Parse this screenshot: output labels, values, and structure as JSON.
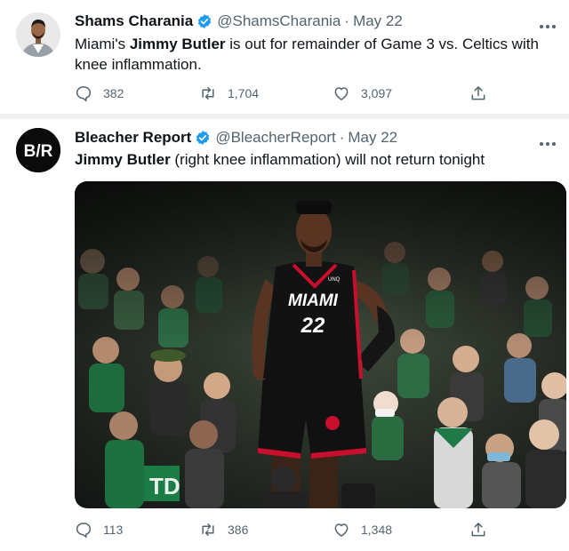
{
  "tweets": [
    {
      "author_name": "Shams Charania",
      "handle": "@ShamsCharania",
      "separator": "·",
      "date": "May 22",
      "text_parts": [
        {
          "text": "Miami's ",
          "bold": false
        },
        {
          "text": "Jimmy Butler",
          "bold": true
        },
        {
          "text": " is out for remainder of Game 3 vs. Celtics with knee inflammation.",
          "bold": false
        }
      ],
      "replies": "382",
      "retweets": "1,704",
      "likes": "3,097"
    },
    {
      "author_name": "Bleacher Report",
      "handle": "@BleacherReport",
      "separator": "·",
      "date": "May 22",
      "avatar_text": "B/R",
      "text_parts": [
        {
          "text": "Jimmy Butler",
          "bold": true
        },
        {
          "text": " (right knee inflammation) will not return tonight",
          "bold": false
        }
      ],
      "media": {
        "jersey_team": "MIAMI",
        "jersey_number": "22",
        "court_sign": "TD",
        "brand_mark": "UNQ"
      },
      "replies": "113",
      "retweets": "386",
      "likes": "1,348"
    }
  ],
  "colors": {
    "verified": "#1d9bf0",
    "secondary_text": "#536471",
    "primary_text": "#0f1419",
    "divider": "#eef0f2"
  },
  "icons": [
    "verified-icon",
    "more-icon",
    "reply-icon",
    "retweet-icon",
    "like-icon",
    "share-icon"
  ]
}
